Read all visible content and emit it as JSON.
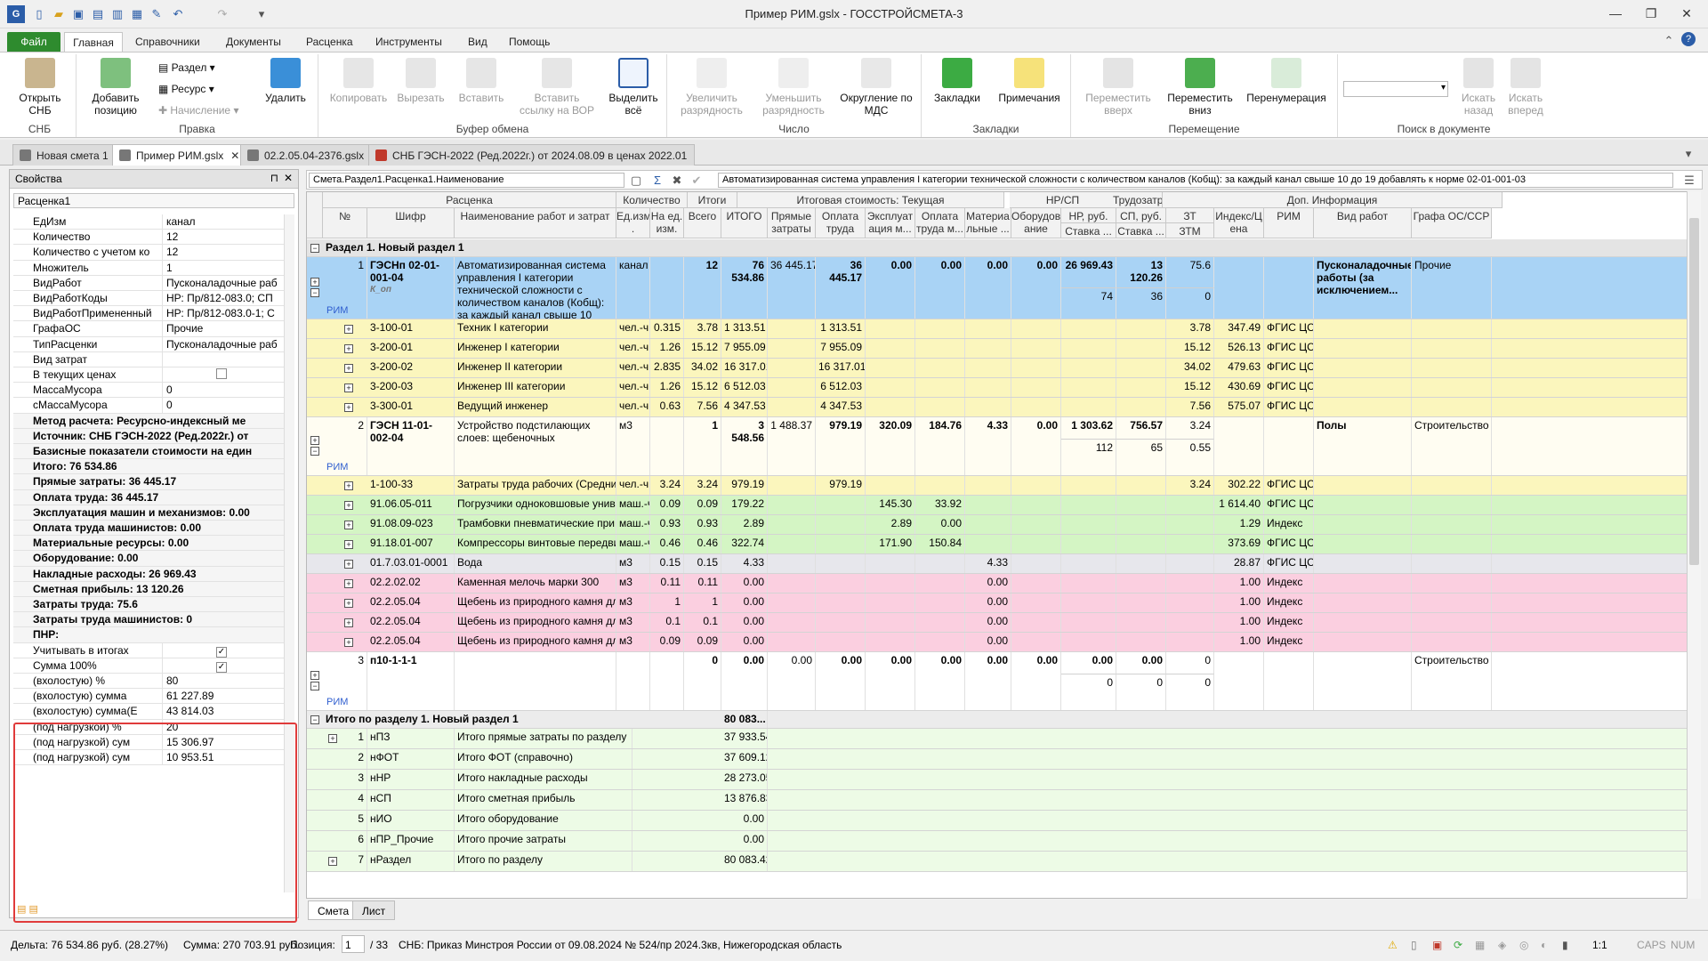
{
  "window": {
    "title": "Пример РИМ.gslx - ГОССТРОЙСМЕТА-3"
  },
  "ribbon_tabs": [
    "Файл",
    "Главная",
    "Справочники",
    "Документы",
    "Расценка",
    "Инструменты",
    "Вид",
    "Помощь"
  ],
  "ribbon": {
    "snb": {
      "open": "Открыть СНБ",
      "group": "СНБ"
    },
    "edit": {
      "add": "Добавить позицию",
      "section": "Раздел",
      "resource": "Ресурс",
      "accrual": "Начисление",
      "delete": "Удалить",
      "group": "Правка"
    },
    "clipboard": {
      "copy": "Копировать",
      "cut": "Вырезать",
      "paste": "Вставить",
      "paste_link": "Вставить ссылку на ВОР",
      "select_all": "Выделить всё",
      "group": "Буфер обмена"
    },
    "number": {
      "inc": "Увеличить разрядность",
      "dec": "Уменьшить разрядность",
      "round": "Округление по МДС",
      "group": "Число"
    },
    "bookmarks": {
      "bookmarks": "Закладки",
      "notes": "Примечания",
      "group": "Закладки"
    },
    "move": {
      "up": "Переместить вверх",
      "down": "Переместить вниз",
      "renum": "Перенумерация",
      "group": "Перемещение"
    },
    "search": {
      "back": "Искать назад",
      "fwd": "Искать вперед",
      "group": "Поиск в документе"
    }
  },
  "doc_tabs": [
    "Новая смета 1",
    "Пример РИМ.gslx",
    "02.2.05.04-2376.gslx",
    "СНБ ГЭСН-2022 (Ред.2022г.) от 2024.08.09 в ценах 2022.01"
  ],
  "props": {
    "title": "Свойства",
    "selector": "Расценка1",
    "rows": [
      {
        "k": "ЕдИзм",
        "v": "канал"
      },
      {
        "k": "Количество",
        "v": "12"
      },
      {
        "k": "Количество с учетом ко",
        "v": "12"
      },
      {
        "k": "Множитель",
        "v": "1"
      },
      {
        "k": "ВидРабот",
        "v": "Пусконаладочные раб"
      },
      {
        "k": "ВидРаботКоды",
        "v": "НР: Пр/812-083.0; СП"
      },
      {
        "k": "ВидРаботПримененный",
        "v": "НР: Пр/812-083.0-1; С"
      },
      {
        "k": "ГрафаОС",
        "v": "Прочие"
      },
      {
        "k": "ТипРасценки",
        "v": "Пусконаладочные раб"
      },
      {
        "k": "Вид затрат",
        "v": ""
      },
      {
        "k": "В текущих ценах",
        "v": "",
        "chk": ""
      },
      {
        "k": "МассаМусора",
        "v": "0"
      },
      {
        "k": "сМассаМусора",
        "v": "0"
      },
      {
        "k": "Метод расчета: Ресурсно-индексный ме",
        "cat": true
      },
      {
        "k": "Источник: СНБ ГЭСН-2022 (Ред.2022г.) от",
        "cat": true
      },
      {
        "k": "Базисные показатели стоимости на един",
        "cat": true,
        "exp": "›"
      },
      {
        "k": "Итого: 76 534.86",
        "cat": true,
        "exp": "›"
      },
      {
        "k": "Прямые затраты: 36 445.17",
        "cat": true,
        "exp": "›"
      },
      {
        "k": "Оплата труда: 36 445.17",
        "cat": true,
        "exp": "›"
      },
      {
        "k": "Эксплуатация машин и механизмов: 0.00",
        "cat": true,
        "exp": "›"
      },
      {
        "k": "Оплата труда машинистов: 0.00",
        "cat": true,
        "exp": "›"
      },
      {
        "k": "Материальные ресурсы: 0.00",
        "cat": true,
        "exp": "›"
      },
      {
        "k": "Оборудование: 0.00",
        "cat": true,
        "exp": "›"
      },
      {
        "k": "Накладные расходы: 26 969.43",
        "cat": true,
        "exp": "›"
      },
      {
        "k": "Сметная прибыль: 13 120.26",
        "cat": true,
        "exp": "›"
      },
      {
        "k": "Затраты труда: 75.6",
        "cat": true,
        "exp": "›"
      },
      {
        "k": "Затраты труда машинистов: 0",
        "cat": true,
        "exp": "›"
      },
      {
        "k": "ПНР:",
        "cat": true,
        "exp": "⌄"
      },
      {
        "k": "Учитывать в итогах",
        "v": "",
        "chk": "✓"
      },
      {
        "k": "Сумма 100%",
        "v": "",
        "chk": "✓"
      },
      {
        "k": "(вхолостую) %",
        "v": "80"
      },
      {
        "k": "(вхолостую) сумма",
        "v": "61 227.89"
      },
      {
        "k": "(вхолостую) сумма(Е",
        "v": "43 814.03"
      },
      {
        "k": "(под нагрузкой) %",
        "v": "20"
      },
      {
        "k": "(под нагрузкой) сум",
        "v": "15 306.97"
      },
      {
        "k": "(под нагрузкой) сум",
        "v": "10 953.51"
      }
    ]
  },
  "formula": {
    "path": "Смета.Раздел1.Расценка1.Наименование",
    "text": "Автоматизированная система управления I категории технической сложности с количеством каналов (Кобщ): за каждый канал свыше 10 до 19 добавлять к норме 02-01-001-03"
  },
  "grid": {
    "group_headers": [
      "Расценка",
      "Количество",
      "Итоги",
      "Итоговая стоимость: Текущая",
      "НР/СП",
      "Трудозатр",
      "Доп. Информация"
    ],
    "headers": [
      "№",
      "Шифр",
      "Наименование работ и затрат",
      "Ед.изм .",
      "На ед. изм.",
      "Всего",
      "ИТОГО",
      "Прямые затраты",
      "Оплата труда",
      "Эксплуат ация м...",
      "Оплата труда м...",
      "Материа льные ...",
      "Оборудов ание",
      "НР, руб.",
      "СП, руб.",
      "ЗТ",
      "Индекс/Ц ена",
      "РИМ",
      "Вид работ",
      "Графа ОС/ССР"
    ],
    "subheaders": [
      "Ставка ...",
      "Ставка ...",
      "ЗТМ"
    ],
    "section": "Раздел 1. Новый раздел 1",
    "pos1": {
      "n": "1",
      "code": "ГЭСНп 02-01-001-04",
      "coef": "К_оп",
      "name": "Автоматизированная система управления I категории технической сложности с количеством каналов (Кобщ): за каждый канал свыше 10",
      "unit": "канал",
      "qty": "12",
      "total": "76 534.86",
      "direct": "36 445.17",
      "labor": "36 445.17",
      "exp": "0.00",
      "labm": "0.00",
      "mat": "0.00",
      "eq": "0.00",
      "nr": "26 969.43",
      "sp": "13 120.26",
      "zt": "75.6",
      "nr2": "74",
      "sp2": "36",
      "ztm": "0",
      "work": "Пусконаладочные работы (за исключением...",
      "os": "Прочие",
      "rim": "РИМ"
    },
    "rows1": [
      {
        "code": "3-100-01",
        "name": "Техник I категории",
        "unit": "чел.-ч",
        "per": "0.315",
        "all": "3.78",
        "total": "1 313.51",
        "labor": "1 313.51",
        "zt": "3.78",
        "idx": "347.49",
        "rim": "ФГИС ЦС"
      },
      {
        "code": "3-200-01",
        "name": "Инженер I категории",
        "unit": "чел.-ч",
        "per": "1.26",
        "all": "15.12",
        "total": "7 955.09",
        "labor": "7 955.09",
        "zt": "15.12",
        "idx": "526.13",
        "rim": "ФГИС ЦС"
      },
      {
        "code": "3-200-02",
        "name": "Инженер II категории",
        "unit": "чел.-ч",
        "per": "2.835",
        "all": "34.02",
        "total": "16 317.01",
        "labor": "16 317.01",
        "zt": "34.02",
        "idx": "479.63",
        "rim": "ФГИС ЦС"
      },
      {
        "code": "3-200-03",
        "name": "Инженер III категории",
        "unit": "чел.-ч",
        "per": "1.26",
        "all": "15.12",
        "total": "6 512.03",
        "labor": "6 512.03",
        "zt": "15.12",
        "idx": "430.69",
        "rim": "ФГИС ЦС"
      },
      {
        "code": "3-300-01",
        "name": "Ведущий инженер",
        "unit": "чел.-ч",
        "per": "0.63",
        "all": "7.56",
        "total": "4 347.53",
        "labor": "4 347.53",
        "zt": "7.56",
        "idx": "575.07",
        "rim": "ФГИС ЦС"
      }
    ],
    "pos2": {
      "n": "2",
      "code": "ГЭСН 11-01-002-04",
      "name": "Устройство подстилающих слоев: щебеночных",
      "unit": "м3",
      "qty": "1",
      "total": "3 548.56",
      "direct": "1 488.37",
      "labor": "979.19",
      "exp": "320.09",
      "labm": "184.76",
      "mat": "4.33",
      "eq": "0.00",
      "nr": "1 303.62",
      "sp": "756.57",
      "zt": "3.24",
      "nr2": "112",
      "sp2": "65",
      "ztm": "0.55",
      "work": "Полы",
      "os": "Строительство",
      "rim": "РИМ"
    },
    "rows2": [
      {
        "code": "1-100-33",
        "name": "Затраты труда рабочих (Средний ...",
        "unit": "чел.-ч",
        "per": "3.24",
        "all": "3.24",
        "total": "979.19",
        "labor": "979.19",
        "zt": "3.24",
        "idx": "302.22",
        "rim": "ФГИС ЦС",
        "bg": "#fbf6bd"
      },
      {
        "code": "91.06.05-011",
        "name": "Погрузчики одноковшовые универ...",
        "unit": "маш.-ч",
        "per": "0.09",
        "all": "0.09",
        "total": "179.22",
        "expv": "145.30",
        "labmv": "33.92",
        "idx": "1 614.40",
        "rim": "ФГИС ЦС",
        "bg": "#d4f5c4"
      },
      {
        "code": "91.08.09-023",
        "name": "Трамбовки пневматические при ра...",
        "unit": "маш.-ч",
        "per": "0.93",
        "all": "0.93",
        "total": "2.89",
        "expv": "2.89",
        "labmv": "0.00",
        "idx": "1.29",
        "rim": "Индекс",
        "bg": "#d4f5c4"
      },
      {
        "code": "91.18.01-007",
        "name": "Компрессоры винтовые передвиж...",
        "unit": "маш.-ч",
        "per": "0.46",
        "all": "0.46",
        "total": "322.74",
        "expv": "171.90",
        "labmv": "150.84",
        "idx": "373.69",
        "rim": "ФГИС ЦС",
        "bg": "#d4f5c4"
      },
      {
        "code": "01.7.03.01-0001",
        "name": "Вода",
        "unit": "м3",
        "per": "0.15",
        "all": "0.15",
        "total": "4.33",
        "matv": "4.33",
        "idx": "28.87",
        "rim": "ФГИС ЦС",
        "bg": "#e7e7ec"
      },
      {
        "code": "02.2.02.02",
        "name": "Каменная мелочь марки 300",
        "unit": "м3",
        "per": "0.11",
        "all": "0.11",
        "total": "0.00",
        "matv": "0.00",
        "idx": "1.00",
        "rim": "Индекс",
        "bg": "#fbcfe0"
      },
      {
        "code": "02.2.05.04",
        "name": "Щебень из природного камня для ...",
        "unit": "м3",
        "per": "1",
        "all": "1",
        "total": "0.00",
        "matv": "0.00",
        "idx": "1.00",
        "rim": "Индекс",
        "bg": "#fbcfe0"
      },
      {
        "code": "02.2.05.04",
        "name": "Щебень из природного камня для ...",
        "unit": "м3",
        "per": "0.1",
        "all": "0.1",
        "total": "0.00",
        "matv": "0.00",
        "idx": "1.00",
        "rim": "Индекс",
        "bg": "#fbcfe0"
      },
      {
        "code": "02.2.05.04",
        "name": "Щебень из природного камня для ...",
        "unit": "м3",
        "per": "0.09",
        "all": "0.09",
        "total": "0.00",
        "matv": "0.00",
        "idx": "1.00",
        "rim": "Индекс",
        "bg": "#fbcfe0"
      }
    ],
    "pos3": {
      "n": "3",
      "code": "п10-1-1-1",
      "qty": "0",
      "total": "0.00",
      "direct": "0.00",
      "labor": "0.00",
      "exp": "0.00",
      "labm": "0.00",
      "mat": "0.00",
      "eq": "0.00",
      "nr": "0.00",
      "sp": "0.00",
      "zt": "0",
      "nr2": "0",
      "sp2": "0",
      "ztm": "0",
      "os": "Строительство",
      "rim": "РИМ"
    },
    "subtotal": {
      "label": "Итого по разделу 1. Новый раздел 1",
      "value": "80 083..."
    },
    "totals": [
      {
        "n": "1",
        "code": "нПЗ",
        "name": "Итого прямые затраты по разделу",
        "val": "37 933.54"
      },
      {
        "n": "2",
        "code": "нФОТ",
        "name": "Итого ФОТ (справочно)",
        "val": "37 609.12"
      },
      {
        "n": "3",
        "code": "нНР",
        "name": "Итого накладные расходы",
        "val": "28 273.05"
      },
      {
        "n": "4",
        "code": "нСП",
        "name": "Итого сметная прибыль",
        "val": "13 876.83"
      },
      {
        "n": "5",
        "code": "нИО",
        "name": "Итого оборудование",
        "val": "0.00"
      },
      {
        "n": "6",
        "code": "нПР_Прочие",
        "name": "Итого прочие затраты",
        "val": "0.00"
      },
      {
        "n": "7",
        "code": "нРаздел",
        "name": "Итого по разделу",
        "val": "80 083.42"
      }
    ]
  },
  "sheet_tabs": [
    "Смета",
    "Лист"
  ],
  "status": {
    "delta": "Дельта: 76 534.86 руб. (28.27%)",
    "sum": "Сумма: 270 703.91 руб.",
    "pos_label": "Позиция:",
    "pos_val": "1",
    "pos_total": "/ 33",
    "snb": "СНБ: Приказ Минстроя России от 09.08.2024 № 524/пр",
    "region": "2024.3кв, Нижегородская область",
    "zoom": "1:1",
    "caps": "CAPS",
    "num": "NUM"
  },
  "colors": {
    "file_tab": "#2e8b2e",
    "pos_selected": "#a9d3f5",
    "labor_row": "#fbf6bd",
    "machine_row": "#d4f5c4",
    "water_row": "#e7e7ec",
    "material_row": "#fbcfe0",
    "highlight_box": "#e03b3b",
    "rim_text": "#2f5ecf"
  }
}
